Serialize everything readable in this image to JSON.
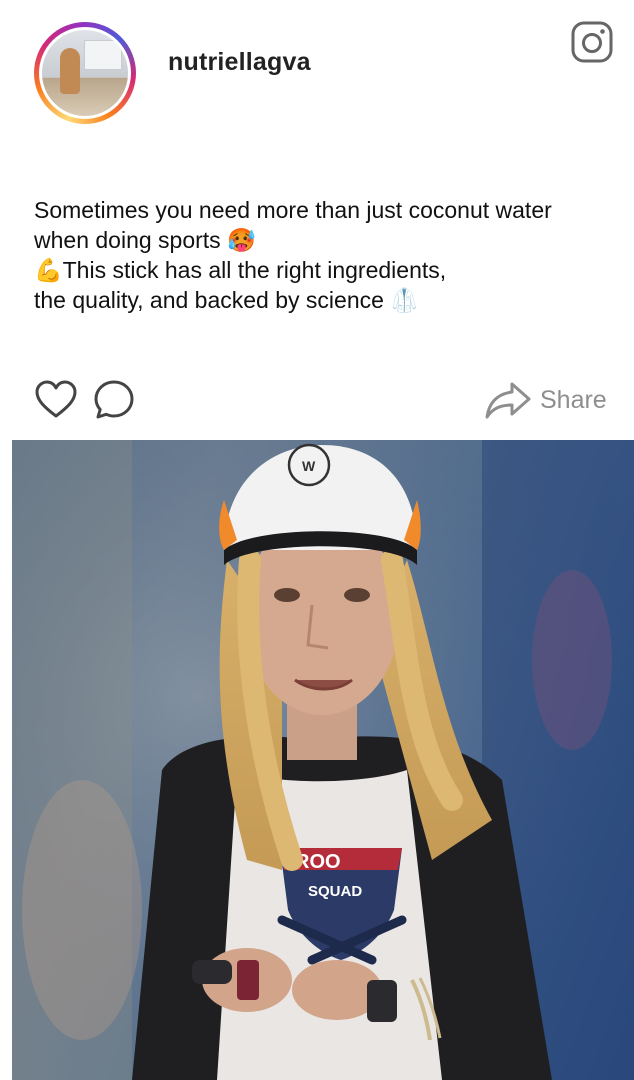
{
  "post": {
    "username": "nutriellagva",
    "caption_lines": [
      "Sometimes you need more than just coconut water",
      "when doing sports 🥵",
      "💪This stick has all the right ingredients,",
      "the quality, and backed by science 🥼"
    ]
  },
  "actions": {
    "share_label": "Share"
  },
  "photo": {
    "cap_logo_text": "W",
    "shirt_text_top": "ROO",
    "shirt_text_bottom": "SQUAD"
  },
  "colors": {
    "share_gray": "#8e8e8e",
    "icon_gray": "#444444",
    "ig_icon": "#666666"
  }
}
